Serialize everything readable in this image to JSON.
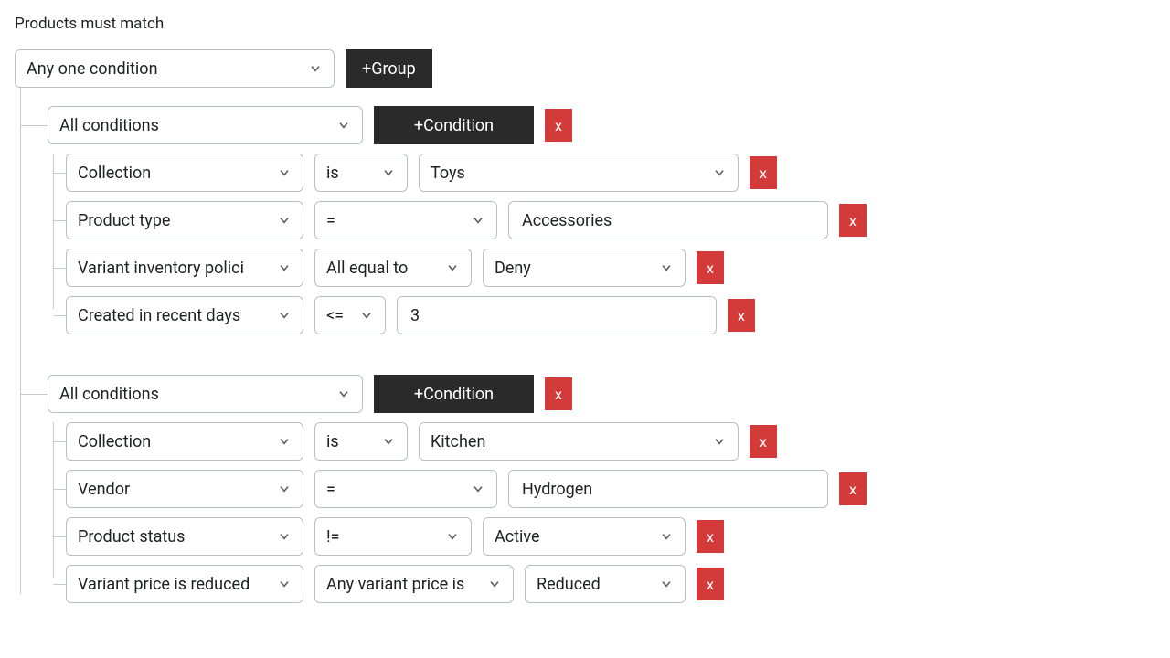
{
  "title": "Products must match",
  "root_condition": "Any one condition",
  "add_group_label": "+Group",
  "add_condition_label": "+Condition",
  "delete_label": "x",
  "groups": [
    {
      "match": "All conditions",
      "conditions": [
        {
          "field": "Collection",
          "op": "is",
          "value": "Toys",
          "layout": "select-narrowop-select"
        },
        {
          "field": "Product type",
          "op": "=",
          "value": "Accessories",
          "layout": "select-wideop-input"
        },
        {
          "field": "Variant inventory polici",
          "op": "All equal to",
          "value": "Deny",
          "layout": "select-select-select-narrow"
        },
        {
          "field": "Created in recent days",
          "op": "<=",
          "value": "3",
          "layout": "select-tinyop-input"
        }
      ]
    },
    {
      "match": "All conditions",
      "conditions": [
        {
          "field": "Collection",
          "op": "is",
          "value": "Kitchen",
          "layout": "select-narrowop-select"
        },
        {
          "field": "Vendor",
          "op": "=",
          "value": "Hydrogen",
          "layout": "select-wideop-input"
        },
        {
          "field": "Product status",
          "op": "!=",
          "value": "Active",
          "layout": "select-select-select-narrow"
        },
        {
          "field": "Variant price is reduced",
          "op": "Any variant price is",
          "value": "Reduced",
          "layout": "select-select-select-narrow2"
        }
      ]
    }
  ]
}
